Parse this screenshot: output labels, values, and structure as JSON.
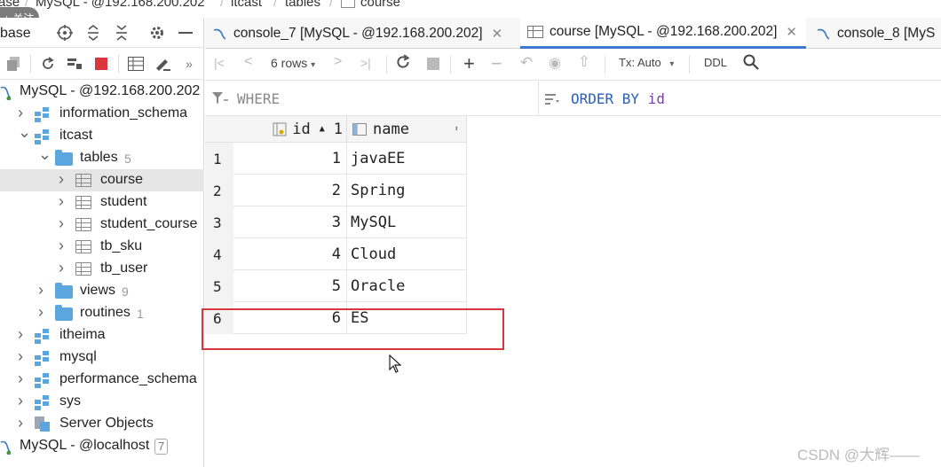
{
  "breadcrumb": {
    "items": [
      "ase",
      "MySQL - @192.168.200.202",
      "itcast",
      "tables",
      "course"
    ],
    "follow_label": "+ 关注"
  },
  "left_panel": {
    "title": "base",
    "tree": [
      {
        "label": "MySQL - @192.168.200.202",
        "count": ""
      },
      {
        "label": "information_schema",
        "count": ""
      },
      {
        "label": "itcast",
        "count": ""
      },
      {
        "label": "tables",
        "count": "5"
      },
      {
        "label": "course",
        "count": ""
      },
      {
        "label": "student",
        "count": ""
      },
      {
        "label": "student_course",
        "count": ""
      },
      {
        "label": "tb_sku",
        "count": ""
      },
      {
        "label": "tb_user",
        "count": ""
      },
      {
        "label": "views",
        "count": "9"
      },
      {
        "label": "routines",
        "count": "1"
      },
      {
        "label": "itheima",
        "count": ""
      },
      {
        "label": "mysql",
        "count": ""
      },
      {
        "label": "performance_schema",
        "count": ""
      },
      {
        "label": "sys",
        "count": ""
      },
      {
        "label": "Server Objects",
        "count": ""
      },
      {
        "label": "MySQL - @localhost",
        "count": "7"
      }
    ]
  },
  "tabs": [
    {
      "label": "console_7 [MySQL - @192.168.200.202]"
    },
    {
      "label": "course [MySQL - @192.168.200.202]"
    },
    {
      "label": "console_8 [MyS"
    }
  ],
  "toolbar": {
    "rows_label": "6 rows",
    "tx_label": "Tx: Auto",
    "ddl_label": "DDL"
  },
  "filter": {
    "where_label": "WHERE",
    "orderby_label": "ORDER BY",
    "orderby_column": "id"
  },
  "grid": {
    "columns": [
      {
        "name": "id",
        "sort": "1"
      },
      {
        "name": "name",
        "sort": ""
      }
    ],
    "rows": [
      {
        "num": "1",
        "id": "1",
        "name": "javaEE"
      },
      {
        "num": "2",
        "id": "2",
        "name": "Spring"
      },
      {
        "num": "3",
        "id": "3",
        "name": "MySQL"
      },
      {
        "num": "4",
        "id": "4",
        "name": "Cloud"
      },
      {
        "num": "5",
        "id": "5",
        "name": "Oracle"
      },
      {
        "num": "6",
        "id": "6",
        "name": "ES"
      }
    ]
  },
  "watermark": "CSDN @大辉——",
  "colors": {
    "accent": "#3b79d0",
    "highlight": "#d9373d",
    "orderby": "#2b5fb4"
  }
}
